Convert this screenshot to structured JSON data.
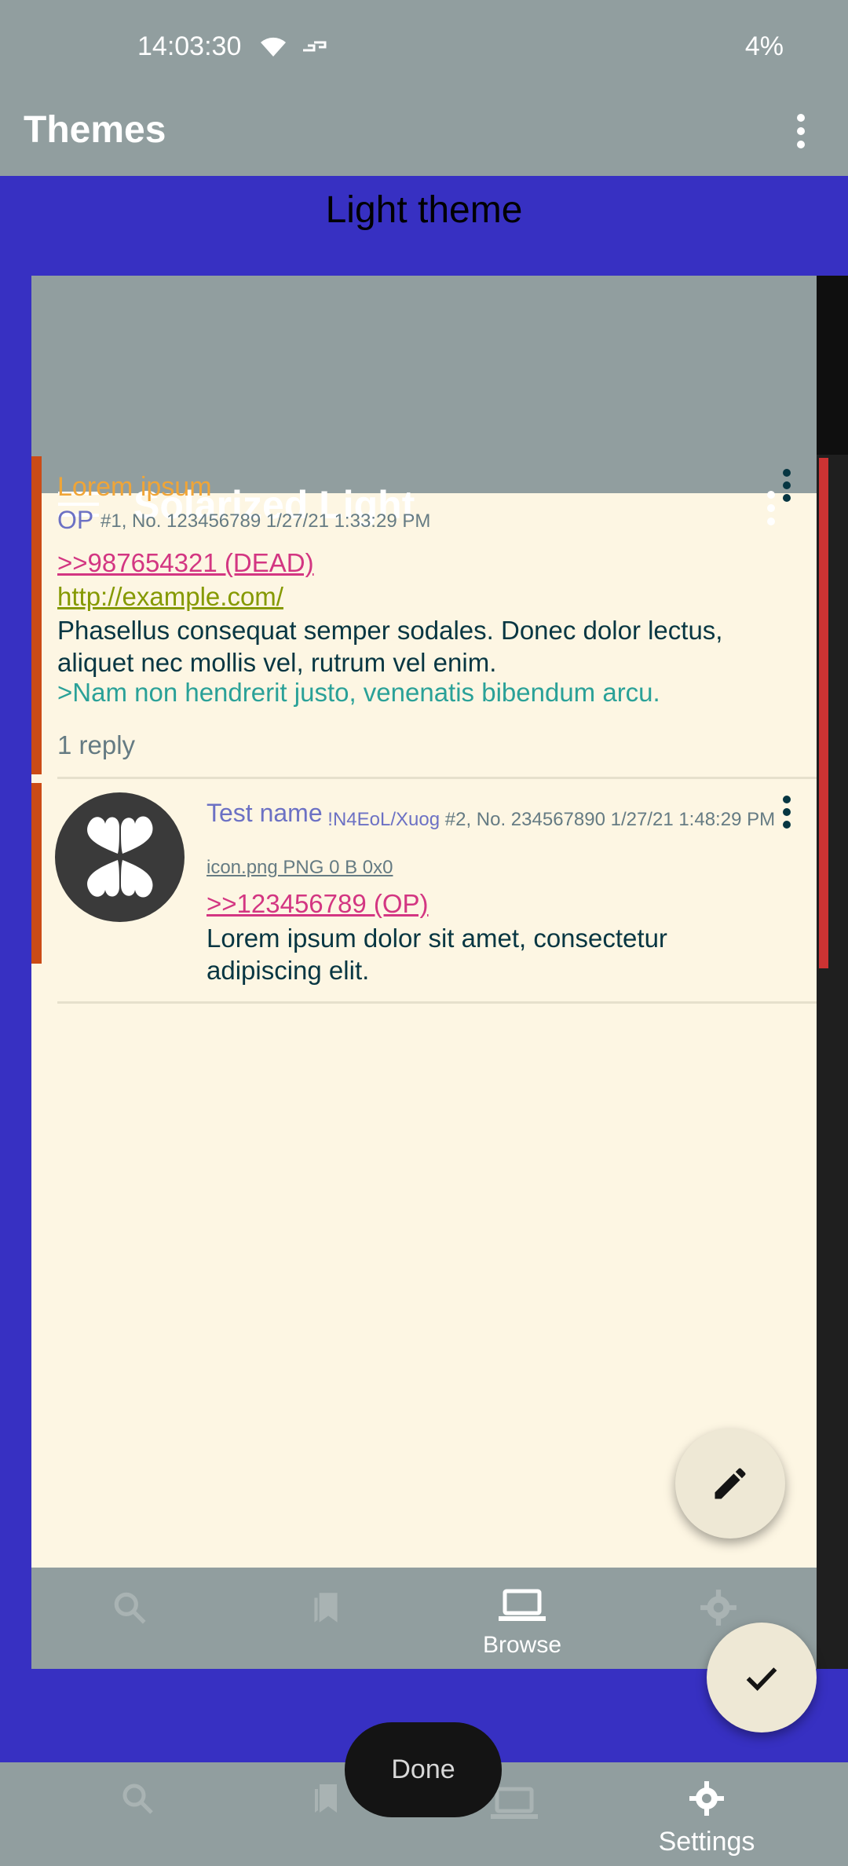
{
  "status_bar": {
    "time": "14:03:30",
    "battery": "4%"
  },
  "toolbar": {
    "title": "Themes"
  },
  "theme": {
    "name": "Light theme"
  },
  "preview": {
    "title": "Solarized Light",
    "post1": {
      "subject": "Lorem ipsum",
      "name": "OP",
      "meta": "#1, No. 123456789 1/27/21 1:33:29 PM",
      "quote": ">>987654321 (DEAD)",
      "link": "http://example.com/",
      "body": "Phasellus consequat semper sodales. Donec dolor lectus, aliquet nec mollis vel, rutrum vel enim.",
      "greentext": ">Nam non hendrerit justo, venenatis bibendum arcu.",
      "replies": "1 reply"
    },
    "post2": {
      "name": "Test name",
      "tripcode": "!N4EoL/Xuog",
      "meta": "#2, No. 234567890 1/27/21 1:48:29 PM",
      "file": "icon.png PNG 0 B 0x0",
      "quote": ">>123456789 (OP)",
      "body": "Lorem ipsum dolor sit amet, consectetur adipiscing elit."
    },
    "nav": {
      "browse_label": "Browse"
    }
  },
  "bottom_nav": {
    "settings_label": "Settings"
  },
  "snackbar": {
    "done_label": "Done"
  },
  "colors": {
    "accent_band": "#3730c2",
    "toolbar": "#919e9f",
    "preview_bg": "#fdf6e3",
    "post_accent": "#cb4b16",
    "fab": "#eee8d5"
  }
}
